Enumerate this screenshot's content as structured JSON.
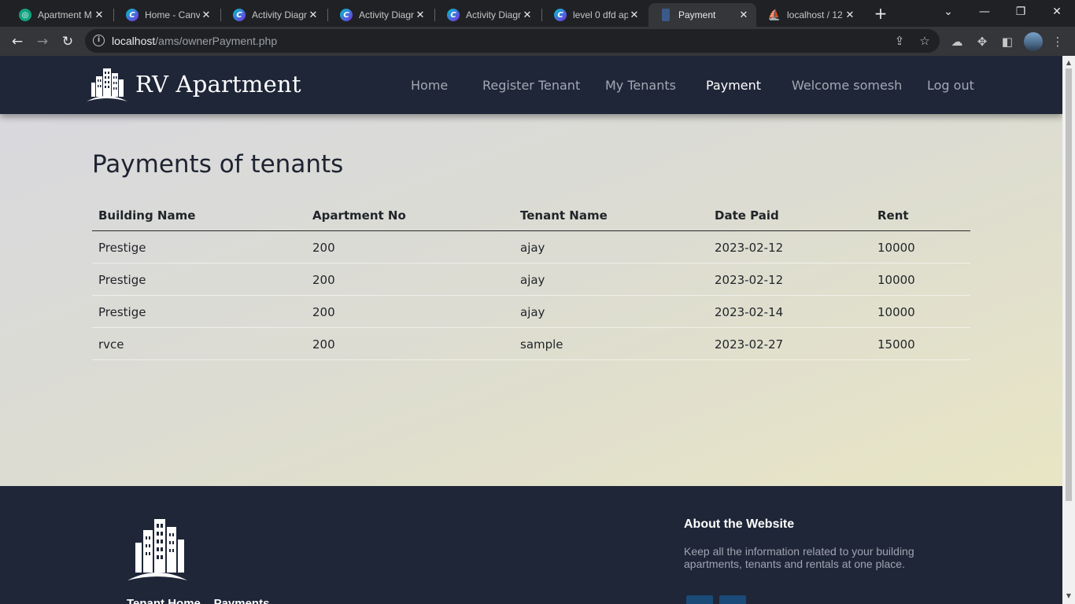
{
  "browser": {
    "tabs": [
      {
        "title": "Apartment M",
        "icon": "chatgpt-icon",
        "active": false
      },
      {
        "title": "Home - Canv",
        "icon": "canva-icon",
        "active": false
      },
      {
        "title": "Activity Diagr",
        "icon": "canva-icon",
        "active": false
      },
      {
        "title": "Activity Diagr",
        "icon": "canva-icon",
        "active": false
      },
      {
        "title": "Activity Diagr",
        "icon": "canva-icon",
        "active": false
      },
      {
        "title": "level 0 dfd ap",
        "icon": "canva-icon",
        "active": false
      },
      {
        "title": "Payment",
        "icon": "building-icon",
        "active": true
      },
      {
        "title": "localhost / 12",
        "icon": "phpmyadmin-icon",
        "active": false
      }
    ],
    "url_host": "localhost",
    "url_path": "/ams/ownerPayment.php"
  },
  "site": {
    "brand": "RV Apartment",
    "nav": [
      "Home",
      "Register Tenant",
      "My Tenants",
      "Payment",
      "Welcome somesh",
      "Log out"
    ],
    "active_nav": "Payment"
  },
  "main": {
    "title": "Payments of tenants",
    "columns": [
      "Building Name",
      "Apartment No",
      "Tenant Name",
      "Date Paid",
      "Rent"
    ],
    "rows": [
      [
        "Prestige",
        "200",
        "ajay",
        "2023-02-12",
        "10000"
      ],
      [
        "Prestige",
        "200",
        "ajay",
        "2023-02-12",
        "10000"
      ],
      [
        "Prestige",
        "200",
        "ajay",
        "2023-02-14",
        "10000"
      ],
      [
        "rvce",
        "200",
        "sample",
        "2023-02-27",
        "15000"
      ]
    ]
  },
  "footer": {
    "title": "Tenant Home    Payments",
    "about_heading": "About the Website",
    "about_text": "Keep all the information related to your building apartments, tenants and rentals at one place."
  },
  "colors": {
    "header_bg": "#1f2638",
    "footer_bg": "#1f2638",
    "chrome_bg": "#202124",
    "toolbar_bg": "#35363a"
  }
}
